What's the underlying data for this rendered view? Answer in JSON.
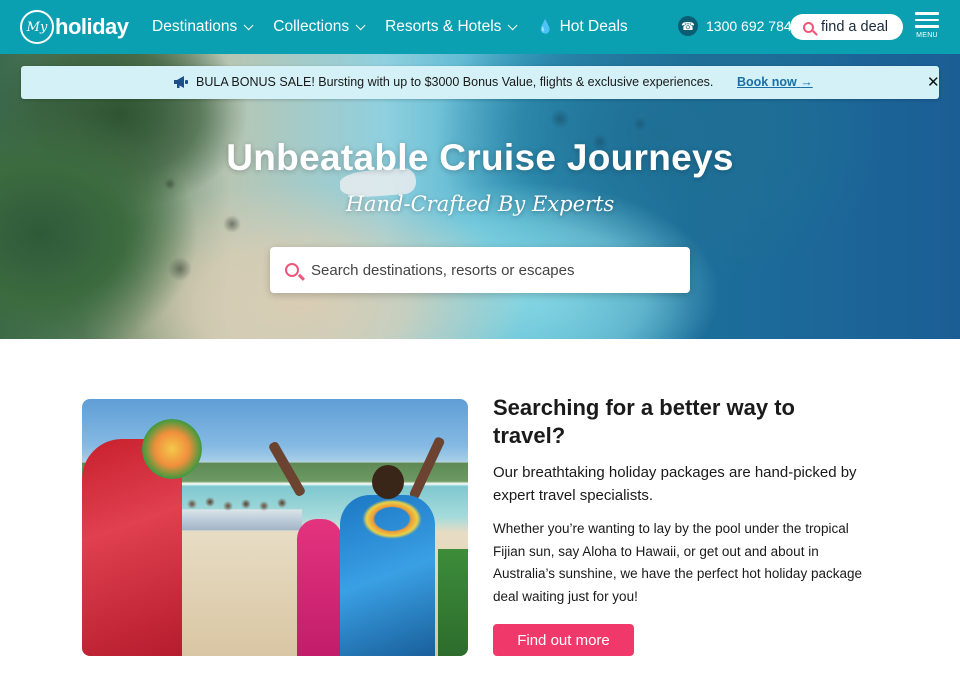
{
  "header": {
    "logo": {
      "script": "My",
      "brand": "holiday"
    },
    "nav": [
      {
        "label": "Destinations",
        "has_dropdown": true
      },
      {
        "label": "Collections",
        "has_dropdown": true
      },
      {
        "label": "Resorts & Hotels",
        "has_dropdown": true
      },
      {
        "label": "Hot Deals",
        "icon": "flame-icon"
      }
    ],
    "phone": "1300 692 784",
    "find_deal_label": "find a deal",
    "menu_label": "MENU",
    "bg_color": "#0b9fb2"
  },
  "promo": {
    "text": "BULA BONUS SALE! Bursting with up to $3000 Bonus Value, flights & exclusive experiences.",
    "link_label": "Book now",
    "close_label": "✕",
    "bg_color": "#d3f1f6"
  },
  "hero": {
    "title": "Unbeatable Cruise Journeys",
    "subtitle": "Hand-Crafted By Experts",
    "search_placeholder": "Search destinations, resorts or escapes"
  },
  "intro": {
    "heading": "Searching for a better way to travel?",
    "lead": "Our breathtaking holiday packages are hand-picked by expert travel specialists.",
    "body": "Whether you’re wanting to lay by the pool under the tropical Fijian sun, say Aloha to Hawaii, or get out and about in Australia’s sunshine, we have the perfect hot holiday package deal waiting just for you!",
    "cta_label": "Find out more",
    "cta_color": "#f0396a"
  }
}
